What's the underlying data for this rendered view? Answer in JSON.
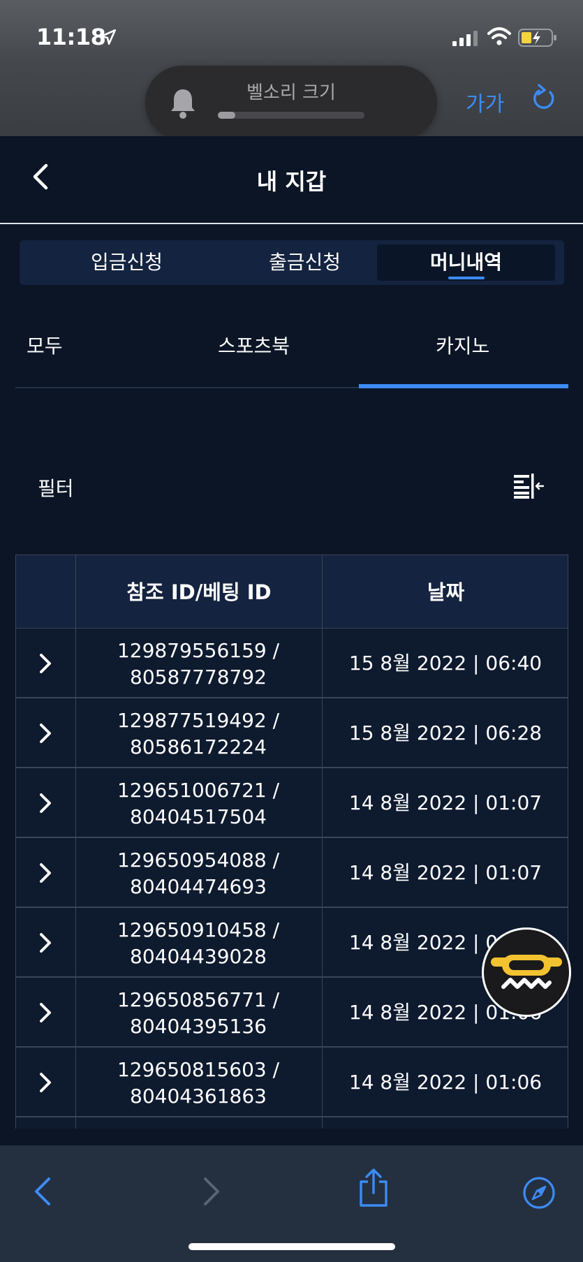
{
  "status_bar": {
    "time": "11:18"
  },
  "volume_hud": {
    "label": "벨소리 크기",
    "level_percent": 12
  },
  "browser": {
    "text_size_button": "가가"
  },
  "header": {
    "title": "내 지갑"
  },
  "main_tabs": [
    {
      "label": "입금신청",
      "active": false
    },
    {
      "label": "출금신청",
      "active": false
    },
    {
      "label": "머니내역",
      "active": true
    }
  ],
  "sub_tabs": [
    {
      "label": "모두",
      "active": false
    },
    {
      "label": "스포츠북",
      "active": false
    },
    {
      "label": "카지노",
      "active": true
    }
  ],
  "filter": {
    "label": "필터"
  },
  "table": {
    "headers": [
      "참조 ID/베팅 ID",
      "날짜"
    ],
    "rows": [
      {
        "ref_id": "129879556159 /",
        "bet_id": "80587778792",
        "date": "15 8월 2022 | 06:40"
      },
      {
        "ref_id": "129877519492 /",
        "bet_id": "80586172224",
        "date": "15 8월 2022 | 06:28"
      },
      {
        "ref_id": "129651006721 /",
        "bet_id": "80404517504",
        "date": "14 8월 2022 | 01:07"
      },
      {
        "ref_id": "129650954088 /",
        "bet_id": "80404474693",
        "date": "14 8월 2022 | 01:07"
      },
      {
        "ref_id": "129650910458 /",
        "bet_id": "80404439028",
        "date": "14 8월 2022 | 01:07"
      },
      {
        "ref_id": "129650856771 /",
        "bet_id": "80404395136",
        "date": "14 8월 2022 | 01:06"
      },
      {
        "ref_id": "129650815603 /",
        "bet_id": "80404361863",
        "date": "14 8월 2022 | 01:06"
      }
    ]
  },
  "colors": {
    "accent": "#3d8bf5",
    "background": "#0b1526",
    "panel": "#14233f"
  }
}
